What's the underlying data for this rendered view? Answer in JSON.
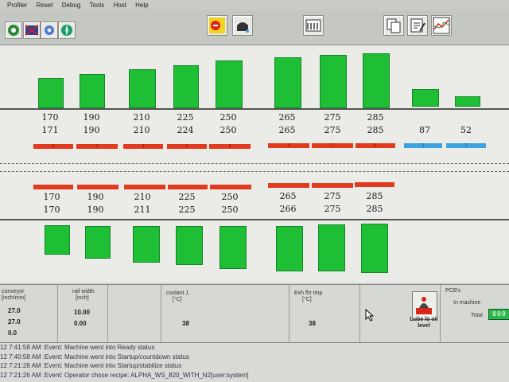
{
  "menu": [
    "Profiler",
    "Reset",
    "Debug",
    "Tools",
    "Host",
    "Help"
  ],
  "top_zones": {
    "setpoints": [
      "170",
      "190",
      "210",
      "225",
      "250",
      "265",
      "275",
      "285"
    ],
    "actuals": [
      "171",
      "190",
      "210",
      "224",
      "250",
      "265",
      "275",
      "285"
    ],
    "zone_numbers": [
      "1",
      "2",
      "3",
      "4",
      "5",
      "6",
      "7",
      "8"
    ],
    "cooling_values": [
      "87",
      "52"
    ],
    "cooling_numbers": [
      "1",
      "2"
    ]
  },
  "bottom_zones": {
    "setpoints": [
      "170",
      "190",
      "210",
      "225",
      "250",
      "265",
      "275",
      "285"
    ],
    "actuals": [
      "170",
      "190",
      "211",
      "225",
      "250",
      "266",
      "275",
      "285"
    ]
  },
  "status": {
    "conveyor_label_1": "conveyor",
    "conveyor_label_2": "[inch/min]",
    "conveyor_values": [
      "27.0",
      "27.0",
      "0.0"
    ],
    "rail_label_1": "rail width",
    "rail_label_2": "[inch]",
    "rail_values": [
      "10.00",
      "0.00"
    ],
    "coolant_label_1": "coolant 1",
    "coolant_label_2": "[°C]",
    "coolant_value": "38",
    "exh_label_1": "Exh fltr tmp",
    "exh_label_2": "[°C]",
    "exh_value": "38",
    "lube_label": "Lube lo oil level",
    "pcb_label": "PCB's",
    "in_machine_label": "In machine",
    "total_label": "Total",
    "total_value": "000"
  },
  "log": [
    "12 7:41:58 AM :Event: Machine went into Ready status",
    "12 7:40:58 AM :Event: Machine went into Startup/countdown status",
    "12 7:21:28 AM :Event: Machine went into Startup/stabilize status",
    "12 7:21:26 AM :Event: Operator chose recipe: ALPHA_WS_820_WITH_N2[user:system]"
  ],
  "colors": {
    "zone_bar": "#1fbf35",
    "heater_indicator": "#e23a1e",
    "cooler_indicator": "#3aa3e0"
  }
}
